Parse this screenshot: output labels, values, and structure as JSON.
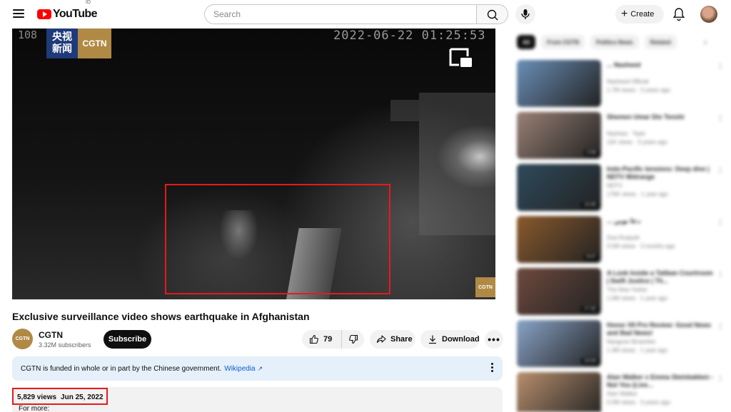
{
  "header": {
    "logo_text": "YouTube",
    "logo_country": "ID",
    "search_placeholder": "Search",
    "create_label": "Create"
  },
  "player": {
    "camera_label": "108",
    "timestamp": "2022-06-22 01:25:53",
    "badge_cn": "央视\n新闻",
    "badge_en": "CGTN",
    "watermark": "CGTN"
  },
  "video": {
    "title": "Exclusive surveillance video shows earthquake in Afghanistan",
    "channel_avatar_text": "CGTN",
    "channel_name": "CGTN",
    "subscribers": "3.32M subscribers",
    "subscribe_label": "Subscribe",
    "likes": "79",
    "share_label": "Share",
    "download_label": "Download",
    "more_label": "•••"
  },
  "notice": {
    "text": "CGTN is funded in whole or in part by the Chinese government.",
    "link": "Wikipedia",
    "external_icon": "↗"
  },
  "description": {
    "views": "5,829 views",
    "date": "Jun 25, 2022",
    "text": "For more:"
  },
  "sidebar": {
    "chips": [
      "All",
      "From CGTN",
      "Politics News",
      "Related"
    ],
    "next_icon": "›",
    "recommendations": [
      {
        "title": "... Nasheed",
        "channel": "Nasheed Official",
        "stats": "1.7M views · 3 years ago",
        "duration": "",
        "thumb_color": "#6b8fb8"
      },
      {
        "title": "Shemen Umar Dio Tenshi",
        "channel": "Nashwa · Topic",
        "stats": "11K views · 3 years ago",
        "duration": "2:59",
        "thumb_color": "#9a8176"
      },
      {
        "title": "Indo-Pacific tensions: Deep dive | NDTV Midrange",
        "channel": "NDTV",
        "stats": "176K views · 1 year ago",
        "duration": "13:35",
        "thumb_color": "#2f4a5c"
      },
      {
        "title": "... دعا نوين",
        "channel": "Doa Ruqiyah",
        "stats": "3.5M views · 3 months ago",
        "duration": "9:47",
        "thumb_color": "#8a5a2c"
      },
      {
        "title": "A Look Inside a Taliban Courtroom | Swift Justice | Th...",
        "channel": "The New Yorker",
        "stats": "1.6M views · 1 year ago",
        "duration": "17:32",
        "thumb_color": "#6e4a3e"
      },
      {
        "title": "Honor X9 Pro Review: Good News and Bad News!",
        "channel": "Nangoon Brownlee",
        "stats": "1.3M views · 1 year ago",
        "duration": "14:04",
        "thumb_color": "#8aa4c8"
      },
      {
        "title": "Alan Walker x Emma Steinbakken - Not You (Live...",
        "channel": "Alan Walker",
        "stats": "5.5M views · 3 years ago",
        "duration": "",
        "thumb_color": "#b88f6e"
      }
    ]
  }
}
